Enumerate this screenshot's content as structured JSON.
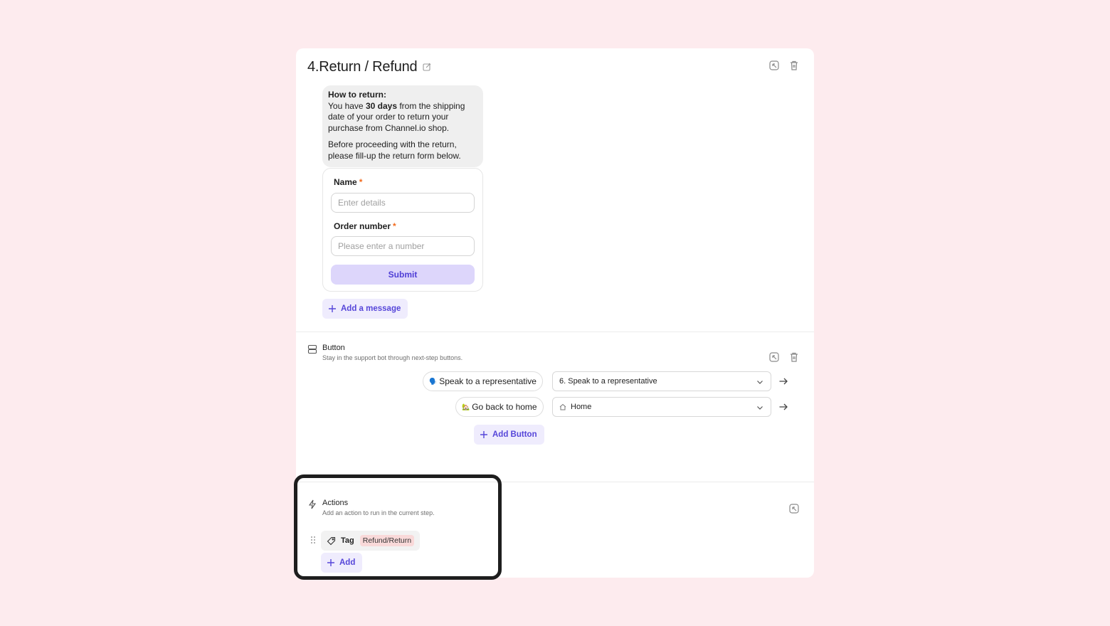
{
  "step": {
    "number": "4.",
    "title": "Return / Refund"
  },
  "message": {
    "heading": "How to return:",
    "line1_pre": "You have ",
    "line1_bold": "30 days",
    "line1_post": " from the shipping date of your order to return your purchase from Channel.io shop.",
    "line2": "Before proceeding with the return, please fill-up the return form below."
  },
  "form": {
    "name_label": "Name",
    "name_placeholder": "Enter details",
    "order_label": "Order number",
    "order_placeholder": "Please enter a number",
    "required_mark": "*",
    "submit_label": "Submit"
  },
  "add_message_label": "Add a message",
  "button_section": {
    "title": "Button",
    "description": "Stay in the support bot through next-step buttons.",
    "buttons": [
      {
        "emoji": "🗣️",
        "label": "Speak to a representative",
        "target": "6. Speak to a representative",
        "target_icon": ""
      },
      {
        "emoji": "🏡",
        "label": "Go back to home",
        "target": "Home",
        "target_icon": "home-icon"
      }
    ],
    "add_button_label": "Add Button"
  },
  "actions_section": {
    "title": "Actions",
    "description": "Add an action to run in the current step.",
    "tag_label": "Tag",
    "tag_value": "Refund/Return",
    "add_label": "Add"
  },
  "colors": {
    "background": "#fdebee",
    "accent": "#5646d9",
    "accent_soft": "#efecfd",
    "submit_bg": "#ddd6fb",
    "tag_value_bg": "#f9d9d9",
    "highlight_border": "#1e1e1e"
  }
}
